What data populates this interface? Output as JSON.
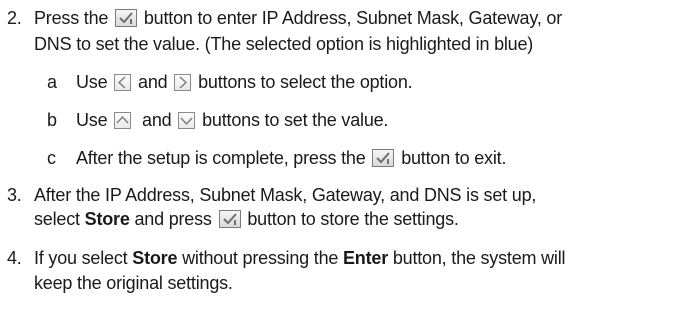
{
  "step2": {
    "num": "2.",
    "line1_pre": "Press the",
    "line1_post": "button to enter IP Address, Subnet Mask, Gateway, or",
    "line2": "DNS to set the value. (The selected option is highlighted in blue)",
    "a": {
      "letter": "a",
      "pre": "Use",
      "mid": "and",
      "post": "buttons to select the option."
    },
    "b": {
      "letter": "b",
      "pre": "Use",
      "mid": "and",
      "post": "buttons to set the value."
    },
    "c": {
      "letter": "c",
      "pre": "After the setup is complete, press the",
      "post": "button to exit."
    }
  },
  "step3": {
    "num": "3.",
    "line1": "After the IP Address, Subnet Mask, Gateway, and DNS is set up,",
    "line2_pre": "select",
    "line2_bold": "Store",
    "line2_mid": "and press",
    "line2_post": "button to store the settings."
  },
  "step4": {
    "num": "4.",
    "line1_pre": "If you select",
    "line1_bold1": "Store",
    "line1_mid": "without pressing the",
    "line1_bold2": "Enter",
    "line1_post": "button, the system will",
    "line2": "keep the original settings."
  },
  "icons": {
    "enter": "enter-check-icon",
    "left": "left-arrow-icon",
    "right": "right-arrow-icon",
    "up": "up-arrow-icon",
    "down": "down-arrow-icon"
  },
  "colors": {
    "text": "#1a1a1a",
    "key_border": "#8a8a8a",
    "glyph": "#7a7a7a"
  }
}
